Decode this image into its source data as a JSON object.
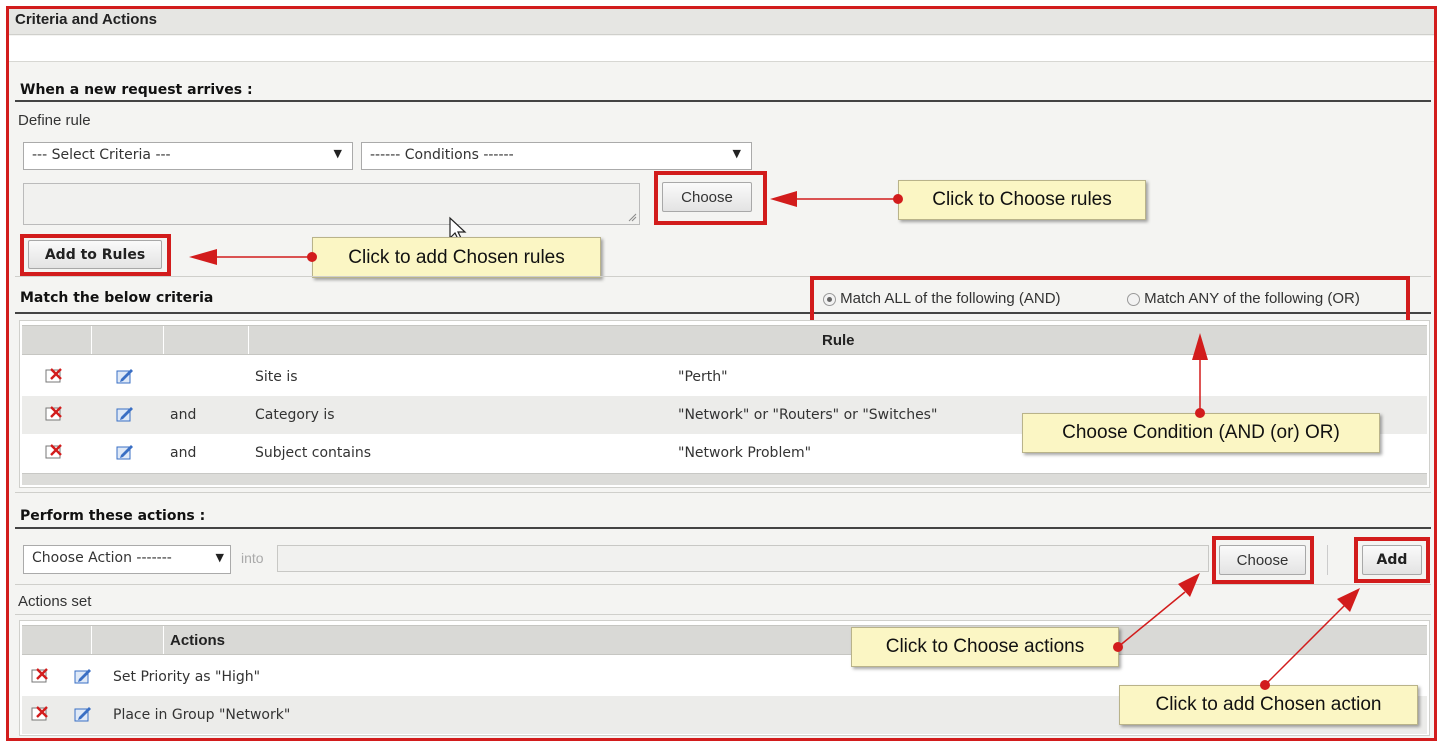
{
  "panel_title": "Criteria and Actions",
  "new_request": {
    "heading": "When a new request arrives :",
    "define_rule_label": "Define rule",
    "criteria_select": "--- Select Criteria ---",
    "conditions_select": "------ Conditions ------",
    "choose_button": "Choose",
    "add_to_rules_button": "Add to Rules"
  },
  "match": {
    "heading": "Match the below criteria",
    "option_all": "Match ALL of the following (AND)",
    "option_any": "Match ANY of the following (OR)",
    "selected": "all"
  },
  "rules_table": {
    "header": "Rule",
    "rows": [
      {
        "connector": "",
        "criteria": "Site is",
        "value": "\"Perth\""
      },
      {
        "connector": "and",
        "criteria": "Category is",
        "value": "\"Network\" or \"Routers\" or \"Switches\""
      },
      {
        "connector": "and",
        "criteria": "Subject contains",
        "value": "\"Network Problem\""
      }
    ]
  },
  "actions": {
    "heading": "Perform these actions :",
    "action_select": "Choose Action -------",
    "into_label": "into",
    "choose_button": "Choose",
    "add_button": "Add",
    "actions_set_label": "Actions set",
    "table_header": "Actions",
    "rows": [
      {
        "text": "Set Priority as \"High\""
      },
      {
        "text": "Place in Group \"Network\""
      }
    ]
  },
  "callouts": {
    "choose_rules": "Click to Choose rules",
    "add_rules": "Click to add Chosen rules",
    "choose_condition": "Choose Condition (AND (or) OR)",
    "choose_actions": "Click to Choose actions",
    "add_action": "Click to add Chosen action"
  },
  "colors": {
    "highlight_red": "#d21c1c",
    "callout_bg": "#fbf6c4",
    "edit_icon_blue": "#3a6fc4"
  },
  "icons": {
    "delete": "delete-icon",
    "edit": "edit-icon"
  }
}
